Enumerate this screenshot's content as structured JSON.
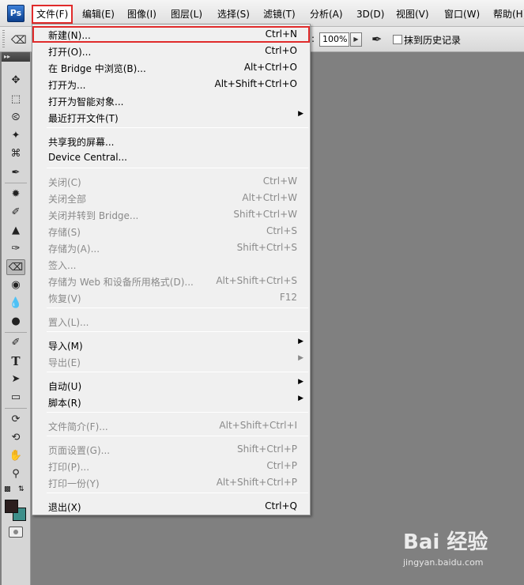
{
  "app": {
    "logo": "Ps"
  },
  "menubar": {
    "items": [
      "文件(F)",
      "编辑(E)",
      "图像(I)",
      "图层(L)",
      "选择(S)",
      "滤镜(T)",
      "分析(A)",
      "3D(D)",
      "视图(V)",
      "窗口(W)",
      "帮助(H)"
    ]
  },
  "options": {
    "flow_label_suffix": ":",
    "flow_value": "100%",
    "erase_to_history_label": "抹到历史记录",
    "erase_to_history_checked": false
  },
  "file_menu": {
    "items": [
      {
        "label": "新建(N)...",
        "shortcut": "Ctrl+N",
        "enabled": true,
        "highlighted": true
      },
      {
        "label": "打开(O)...",
        "shortcut": "Ctrl+O",
        "enabled": true
      },
      {
        "label": "在 Bridge 中浏览(B)...",
        "shortcut": "Alt+Ctrl+O",
        "enabled": true
      },
      {
        "label": "打开为...",
        "shortcut": "Alt+Shift+Ctrl+O",
        "enabled": true
      },
      {
        "label": "打开为智能对象...",
        "shortcut": "",
        "enabled": true
      },
      {
        "label": "最近打开文件(T)",
        "shortcut": "",
        "enabled": true,
        "submenu": true
      },
      {
        "label": "共享我的屏幕...",
        "shortcut": "",
        "enabled": true
      },
      {
        "label": "Device Central...",
        "shortcut": "",
        "enabled": true
      },
      {
        "label": "关闭(C)",
        "shortcut": "Ctrl+W",
        "enabled": false
      },
      {
        "label": "关闭全部",
        "shortcut": "Alt+Ctrl+W",
        "enabled": false
      },
      {
        "label": "关闭并转到 Bridge...",
        "shortcut": "Shift+Ctrl+W",
        "enabled": false
      },
      {
        "label": "存储(S)",
        "shortcut": "Ctrl+S",
        "enabled": false
      },
      {
        "label": "存储为(A)...",
        "shortcut": "Shift+Ctrl+S",
        "enabled": false
      },
      {
        "label": "签入...",
        "shortcut": "",
        "enabled": false
      },
      {
        "label": "存储为 Web 和设备所用格式(D)...",
        "shortcut": "Alt+Shift+Ctrl+S",
        "enabled": false
      },
      {
        "label": "恢复(V)",
        "shortcut": "F12",
        "enabled": false
      },
      {
        "label": "置入(L)...",
        "shortcut": "",
        "enabled": false
      },
      {
        "label": "导入(M)",
        "shortcut": "",
        "enabled": true,
        "submenu": true
      },
      {
        "label": "导出(E)",
        "shortcut": "",
        "enabled": false,
        "submenu": true
      },
      {
        "label": "自动(U)",
        "shortcut": "",
        "enabled": true,
        "submenu": true
      },
      {
        "label": "脚本(R)",
        "shortcut": "",
        "enabled": true,
        "submenu": true
      },
      {
        "label": "文件简介(F)...",
        "shortcut": "Alt+Shift+Ctrl+I",
        "enabled": false
      },
      {
        "label": "页面设置(G)...",
        "shortcut": "Shift+Ctrl+P",
        "enabled": false
      },
      {
        "label": "打印(P)...",
        "shortcut": "Ctrl+P",
        "enabled": false
      },
      {
        "label": "打印一份(Y)",
        "shortcut": "Alt+Shift+Ctrl+P",
        "enabled": false
      },
      {
        "label": "退出(X)",
        "shortcut": "Ctrl+Q",
        "enabled": true
      }
    ]
  },
  "watermark": {
    "logo": "Bai 经验",
    "url": "jingyan.baidu.com"
  },
  "colors": {
    "foreground": "#2b1e1e",
    "background": "#3e8f8a",
    "highlight_border": "#e02b2b"
  }
}
